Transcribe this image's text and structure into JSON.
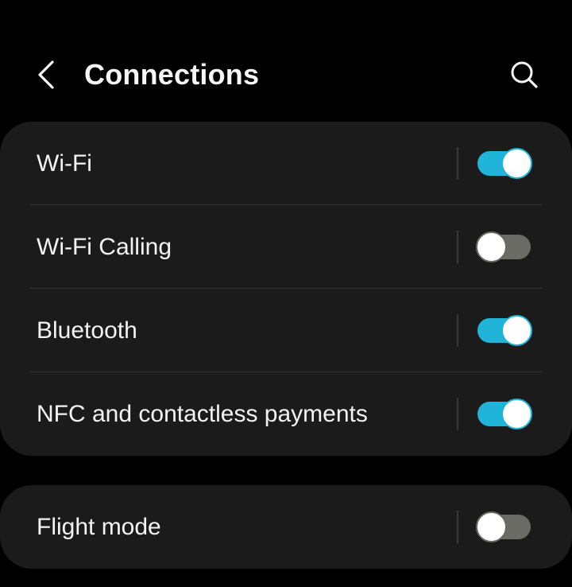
{
  "header": {
    "title": "Connections",
    "back_icon": "chevron-left-icon",
    "search_icon": "search-icon"
  },
  "colors": {
    "background": "#000000",
    "card": "#1b1b1b",
    "toggle_on": "#1fb4d8",
    "toggle_off": "#6b6b65"
  },
  "settings": {
    "items": [
      {
        "label": "Wi-Fi",
        "enabled": true
      },
      {
        "label": "Wi-Fi Calling",
        "enabled": false
      },
      {
        "label": "Bluetooth",
        "enabled": true
      },
      {
        "label": "NFC and contactless payments",
        "enabled": true
      }
    ]
  },
  "flight": {
    "label": "Flight mode",
    "enabled": false
  }
}
